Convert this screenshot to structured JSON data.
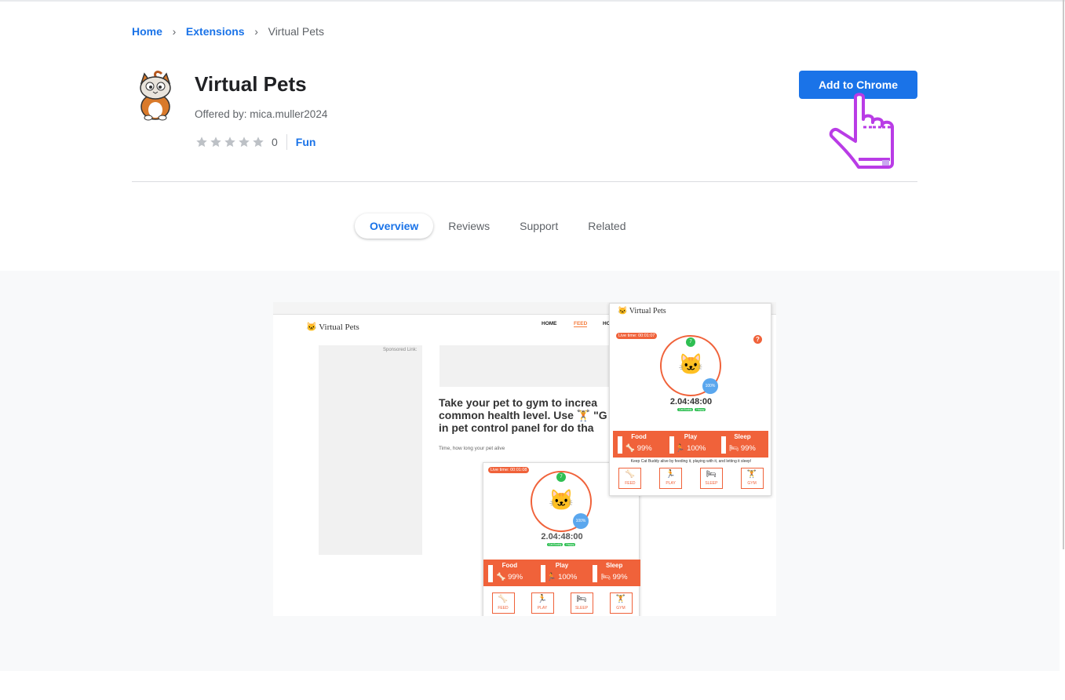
{
  "breadcrumb": {
    "home": "Home",
    "extensions": "Extensions",
    "current": "Virtual Pets"
  },
  "extension": {
    "title": "Virtual Pets",
    "offered_by": "Offered by: mica.muller2024",
    "rating_count": "0",
    "rating_value": 0,
    "rating_max": 5,
    "category": "Fun"
  },
  "add_button": {
    "label": "Add to Chrome"
  },
  "tabs": [
    {
      "label": "Overview",
      "active": true
    },
    {
      "label": "Reviews",
      "active": false
    },
    {
      "label": "Support",
      "active": false
    },
    {
      "label": "Related",
      "active": false
    }
  ],
  "screenshot": {
    "site_logo": "Virtual Pets",
    "nav_home": "HOME",
    "nav_feed": "FEED",
    "nav_more": "HO",
    "sponsored": "Sponsored Link:",
    "promo": "Take your pet to gym to increa\ncommon health level. Use 🏋 \"G\nin pet control panel for do tha",
    "time_note": "Time, how long your pet alive",
    "popup_title": "Virtual Pets",
    "front_live": "Live time: 00:01:07",
    "back_live": "Live time: 00:01:08",
    "level": "7",
    "percent": "100%",
    "clock": "2.04:48:00",
    "tag_name": "Cat Buddy",
    "tag_mood": "Happy",
    "stat_food_label": "Food",
    "stat_food_value": "99%",
    "stat_play_label": "Play",
    "stat_play_value": "100%",
    "stat_sleep_label": "Sleep",
    "stat_sleep_value": "99%",
    "keep_note": "Keep Cat Buddy alive by feeding it, playing with it, and letting it sleep!",
    "act_feed": "FEED",
    "act_play": "PLAY",
    "act_sleep": "SLEEP",
    "act_gym": "GYM",
    "help": "?"
  },
  "colors": {
    "accent": "#1a73e8",
    "pet_orange": "#f0623a",
    "pointer_purple": "#b93ce6"
  }
}
